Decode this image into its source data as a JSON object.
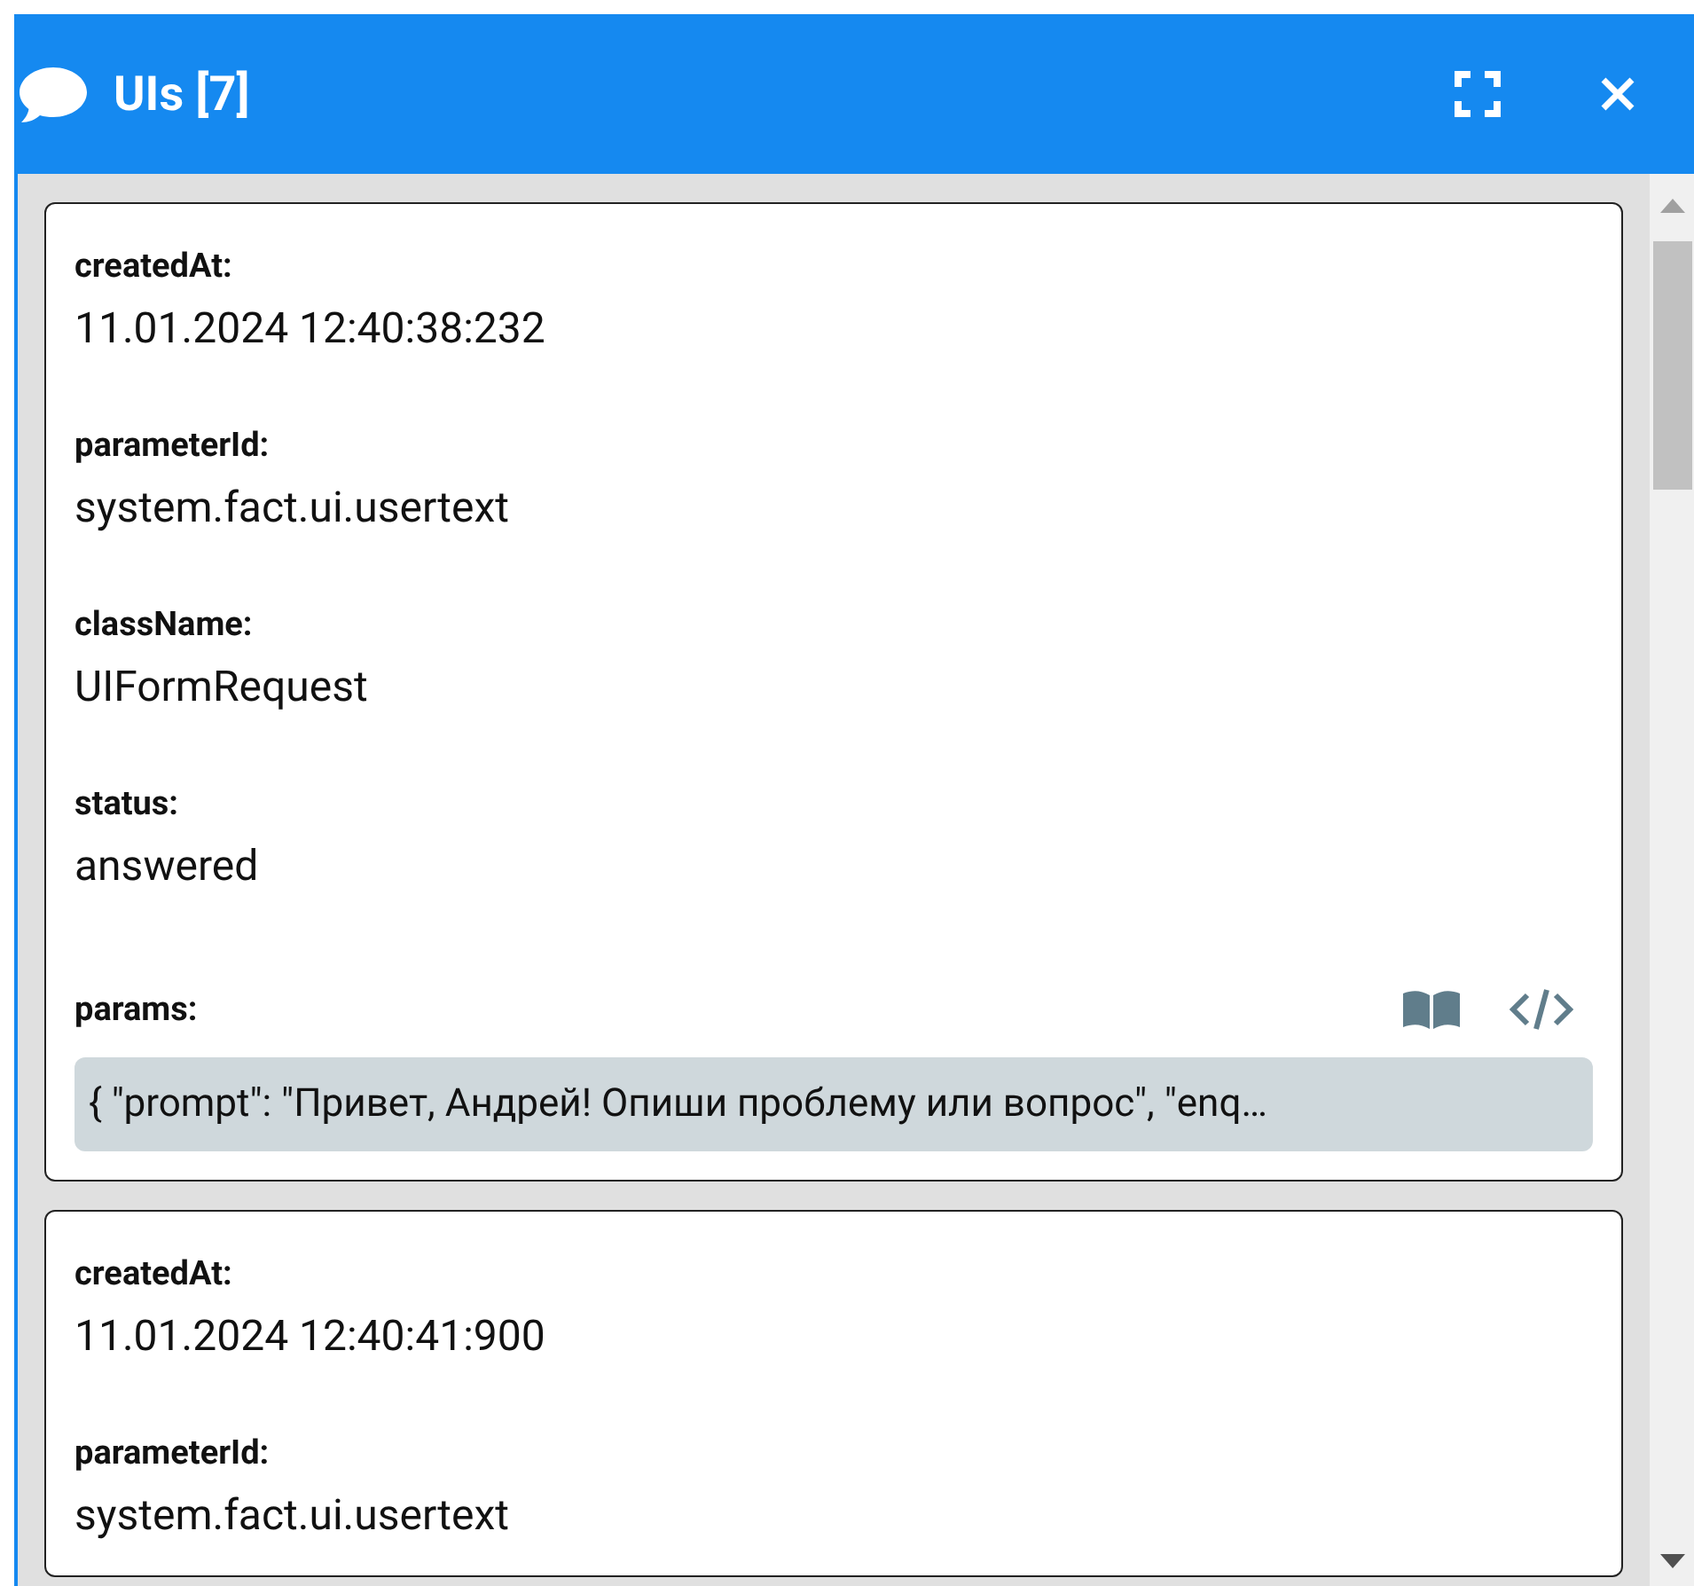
{
  "window": {
    "title": "UIs [7]"
  },
  "records": [
    {
      "fields": [
        {
          "kind": "text",
          "label": "createdAt:",
          "value": "11.01.2024 12:40:38:232"
        },
        {
          "kind": "text",
          "label": "parameterId:",
          "value": "system.fact.ui.usertext"
        },
        {
          "kind": "text",
          "label": "className:",
          "value": "UIFormRequest"
        },
        {
          "kind": "text",
          "label": "status:",
          "value": "answered"
        },
        {
          "kind": "code",
          "label": "params:",
          "value": "{ \"prompt\": \"Привет, Андрей! Опиши проблему или вопрос\", \"enq…"
        }
      ]
    },
    {
      "fields": [
        {
          "kind": "text",
          "label": "createdAt:",
          "value": "11.01.2024 12:40:41:900"
        },
        {
          "kind": "text",
          "label": "parameterId:",
          "value": "system.fact.ui.usertext"
        }
      ]
    }
  ]
}
